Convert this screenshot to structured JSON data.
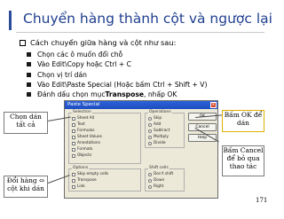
{
  "slide": {
    "title": "Chuyển hàng thành cột và ngược lại",
    "heading": "Cách chuyển giữa hàng và cột như sau:",
    "bullets": [
      {
        "text": "Chọn các ô muốn đổi chỗ"
      },
      {
        "text": "Vào Edit\\Copy hoặc Ctrl + C"
      },
      {
        "text": "Chọn vị trí dán"
      },
      {
        "text": "Vào Edit\\Paste Special (Hoặc bấm Ctrl + Shift + V)"
      },
      {
        "text_before": "Đánh dấu chọn mục ",
        "bold": "Transpose",
        "text_after": ", nhấp OK"
      }
    ],
    "page_number": "171"
  },
  "dialog": {
    "title": "Paste Special",
    "close_glyph": "x",
    "paste_group": {
      "label": "Selection",
      "options": [
        "Sheet All",
        "Text",
        "Formulas",
        "Sheet Values",
        "Annotations",
        "Formats",
        "Objects"
      ]
    },
    "operations_group": {
      "label": "Operations",
      "options": [
        "Skip",
        "Add",
        "Subtract",
        "Multiply",
        "Divide"
      ]
    },
    "options_group": {
      "label": "Options",
      "options": [
        "Skip empty cells",
        "Transpose",
        "Link"
      ]
    },
    "shift_group": {
      "label": "Shift cells",
      "options": [
        "Don't shift",
        "Down",
        "Right"
      ]
    },
    "ok_label": "OK",
    "cancel_label": "Cancel",
    "help_label": "Help"
  },
  "callouts": {
    "select_all": "Chọn dán tất cả",
    "transpose": "Đổi hàng ⇔ cột khi dán",
    "ok": "Bấm OK để dán",
    "cancel": "Bấm Cancel để bỏ qua thao tác"
  },
  "colors": {
    "title": "#1f3f8f",
    "dialog_title_bar": "#1d4dbf",
    "callout_accent": "#e0b100"
  }
}
